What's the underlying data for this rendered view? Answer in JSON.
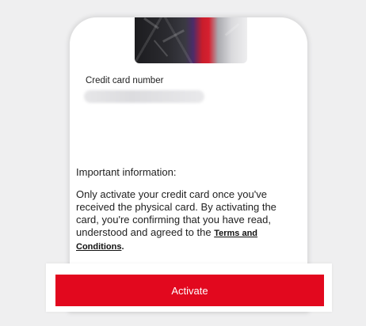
{
  "card": {
    "number_label": "Credit card number",
    "number_value": "•••• •••• •••• ••••"
  },
  "info": {
    "title": "Important information:",
    "body": "Only activate your credit card once you've received the physical card. By activating the card, you're confirming that you have read, understood and agreed to the ",
    "terms_link": "Terms and Conditions",
    "terms_suffix": "."
  },
  "actions": {
    "activate_label": "Activate"
  },
  "colors": {
    "accent": "#e2081e",
    "background": "#efeff0"
  }
}
